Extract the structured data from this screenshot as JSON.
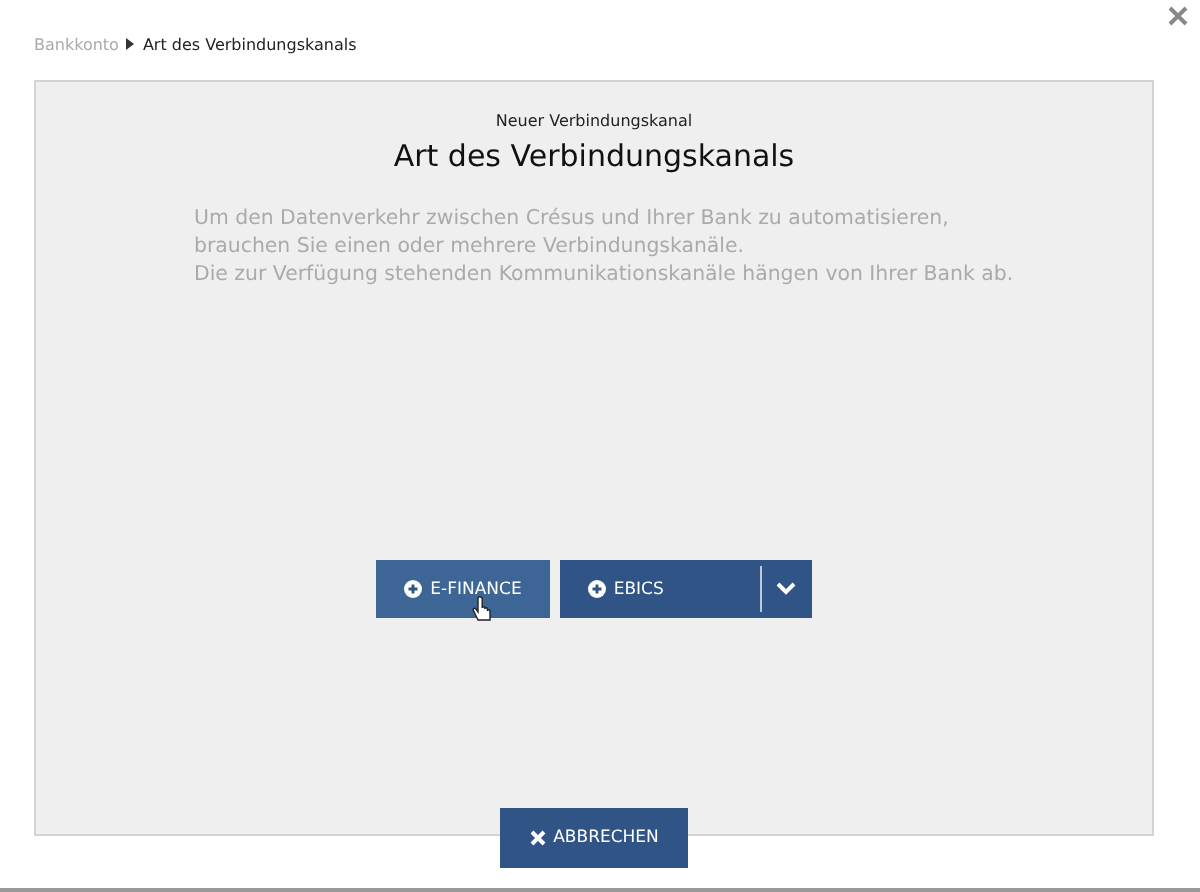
{
  "breadcrumb": [
    {
      "label": "Bankkonto",
      "current": false
    },
    {
      "label": "Art des Verbindungskanals",
      "current": true
    }
  ],
  "dialog": {
    "subtitle": "Neuer Verbindungskanal",
    "title": "Art des Verbindungskanals",
    "description": "Um den Datenverkehr zwischen Crésus und Ihrer Bank zu automatisieren,\nbrauchen Sie einen oder mehrere Verbindungskanäle.\nDie zur Verfügung stehenden Kommunikationskanäle hängen von Ihrer Bank ab."
  },
  "options": [
    {
      "label": "E-FINANCE",
      "kind": "plain",
      "hovered": true
    },
    {
      "label": "EBICS",
      "kind": "split",
      "hovered": false
    }
  ],
  "cancel_button": "ABBRECHEN"
}
